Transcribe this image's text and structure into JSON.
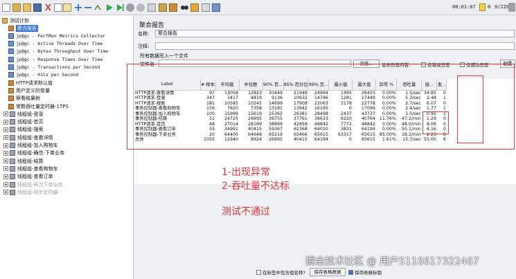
{
  "toolbar": {
    "elapsed": "00:01:07",
    "warnings": "0",
    "threads": "0/220"
  },
  "tree": {
    "root": "测试计划",
    "items": [
      {
        "label": "聚合报告",
        "mono": false,
        "selected": true,
        "expander": false,
        "disabled": false
      },
      {
        "label": "jp@gc - PerfMon Metrics Collector",
        "mono": true,
        "selected": false,
        "expander": false,
        "disabled": false
      },
      {
        "label": "jp@gc - Active Threads Over Time",
        "mono": true,
        "selected": false,
        "expander": false,
        "disabled": false
      },
      {
        "label": "jp@gc - Bytes Throughput Over Time",
        "mono": true,
        "selected": false,
        "expander": false,
        "disabled": false
      },
      {
        "label": "jp@gc - Response Times Over Time",
        "mono": true,
        "selected": false,
        "expander": false,
        "disabled": false
      },
      {
        "label": "jp@gc - Transactions per Second",
        "mono": true,
        "selected": false,
        "expander": false,
        "disabled": false
      },
      {
        "label": "jp@gc - Hits per Second",
        "mono": true,
        "selected": false,
        "expander": false,
        "disabled": false
      },
      {
        "label": "HTTP请求默认值",
        "mono": false,
        "selected": false,
        "expander": false,
        "disabled": false
      },
      {
        "label": "用户定义的变量",
        "mono": false,
        "selected": false,
        "expander": false,
        "disabled": false
      },
      {
        "label": "察看结果树",
        "mono": false,
        "selected": false,
        "expander": false,
        "disabled": false
      },
      {
        "label": "常数吞吐量定时器-1TPS",
        "mono": false,
        "selected": false,
        "expander": false,
        "disabled": false
      },
      {
        "label": "线程组-登录",
        "mono": false,
        "selected": false,
        "expander": true,
        "disabled": false
      },
      {
        "label": "线程组-首页",
        "mono": false,
        "selected": false,
        "expander": true,
        "disabled": false
      },
      {
        "label": "线程组-搜索",
        "mono": false,
        "selected": false,
        "expander": true,
        "disabled": false
      },
      {
        "label": "线程组-查看详情",
        "mono": false,
        "selected": false,
        "expander": true,
        "disabled": false
      },
      {
        "label": "线程组-加入购物车",
        "mono": false,
        "selected": false,
        "expander": true,
        "disabled": false
      },
      {
        "label": "线程组-确信-下单业务",
        "mono": false,
        "selected": false,
        "expander": true,
        "disabled": false
      },
      {
        "label": "线程组-结算",
        "mono": false,
        "selected": false,
        "expander": true,
        "disabled": false
      },
      {
        "label": "线程组-查看购物车",
        "mono": false,
        "selected": false,
        "expander": true,
        "disabled": false
      },
      {
        "label": "线程组-查看订单",
        "mono": false,
        "selected": false,
        "expander": true,
        "disabled": false
      },
      {
        "label": "线程组-再次下单业务",
        "mono": false,
        "selected": false,
        "expander": true,
        "disabled": true
      },
      {
        "label": "线程组-同步定时器",
        "mono": false,
        "selected": false,
        "expander": true,
        "disabled": true
      }
    ]
  },
  "panel": {
    "title": "聚合报告",
    "name_label": "名称:",
    "name_value": "聚合报告",
    "comment_label": "注释:",
    "comment_value": "",
    "write_all_label": "所有数据写入一个文件",
    "filename_label": "文件名",
    "browse_btn": "浏览...",
    "log_display_label": "显示日志内容:",
    "errors_only_label": "仅错误日志",
    "success_only_label": "仅成功日志",
    "config_btn": "配置"
  },
  "table": {
    "columns": [
      "Label",
      "# 样本",
      "平均值",
      "中位数",
      "90% 百...",
      "95% 百分位",
      "99% 百...",
      "最小值",
      "最大值",
      "异常 %",
      "吞吐量",
      "接...",
      "发..."
    ],
    "rows": [
      [
        "HTTP请求-查看详情",
        "97",
        "13058",
        "12823",
        "20449",
        "21948",
        "24994",
        "1495",
        "26433",
        "0.00%",
        "1.5/sec",
        "34.85",
        "0"
      ],
      [
        "HTTP请求-登录",
        "347",
        "3417",
        "4819",
        "9136",
        "10632",
        "14746",
        "1281",
        "17449",
        "0.00%",
        "5.3/sec",
        "2.48",
        "1"
      ],
      [
        "HTTP请求-搜索",
        "181",
        "10585",
        "10245",
        "14699",
        "17908",
        "22063",
        "3178",
        "22778",
        "0.00%",
        "2.7/sec",
        "6.07",
        "0"
      ],
      [
        "事务控制器-查看购物车",
        "156",
        "7820",
        "7358",
        "13181",
        "13942",
        "16195",
        "0",
        "17096",
        "0.00%",
        "2.4/sec",
        "1.77",
        "1"
      ],
      [
        "事务控制器-加入购物车",
        "100",
        "15999",
        "15619",
        "25362",
        "26381",
        "28498",
        "2437",
        "43737",
        "0.00%",
        "1.5/sec",
        "0.95",
        "1"
      ],
      [
        "事务控制器-结算",
        "51",
        "24725",
        "26995",
        "36755",
        "37761",
        "38633",
        "6220",
        "40764",
        "11.76%",
        "47.2/min",
        "1.29",
        "0"
      ],
      [
        "HTTP请求-首页",
        "48",
        "27014",
        "28189",
        "38899",
        "42858",
        "48842",
        "7772",
        "48842",
        "0.00%",
        "48.0/min",
        "8.06",
        "0"
      ],
      [
        "事务控制器-查看订单",
        "55",
        "34991",
        "40415",
        "59367",
        "62368",
        "64010",
        "3831",
        "64194",
        "0.00%",
        "50.1/min",
        "4.16",
        "0"
      ],
      [
        "事务控制器-下单业务",
        "20",
        "64400",
        "64648",
        "65219",
        "65466",
        "65615",
        "63317",
        "65615",
        "85.00%",
        "18.2/min",
        "2.23",
        "0"
      ],
      [
        "总体",
        "1055",
        "12940",
        "8924",
        "26995",
        "40415",
        "64194",
        "0",
        "65615",
        "1.61%",
        "15.7/sec",
        "55.00",
        "6"
      ]
    ]
  },
  "annotations": {
    "line1": "1-出现异常",
    "line2": "2-吞吐量不达标",
    "line3": "测试不通过"
  },
  "bottom": {
    "include_group_label": "在标签中包含组名称?",
    "save_btn": "保存表格数据",
    "save_header_label": "保存表格标题"
  },
  "watermark": "掘金技术社区 @ 用户5116617322467"
}
